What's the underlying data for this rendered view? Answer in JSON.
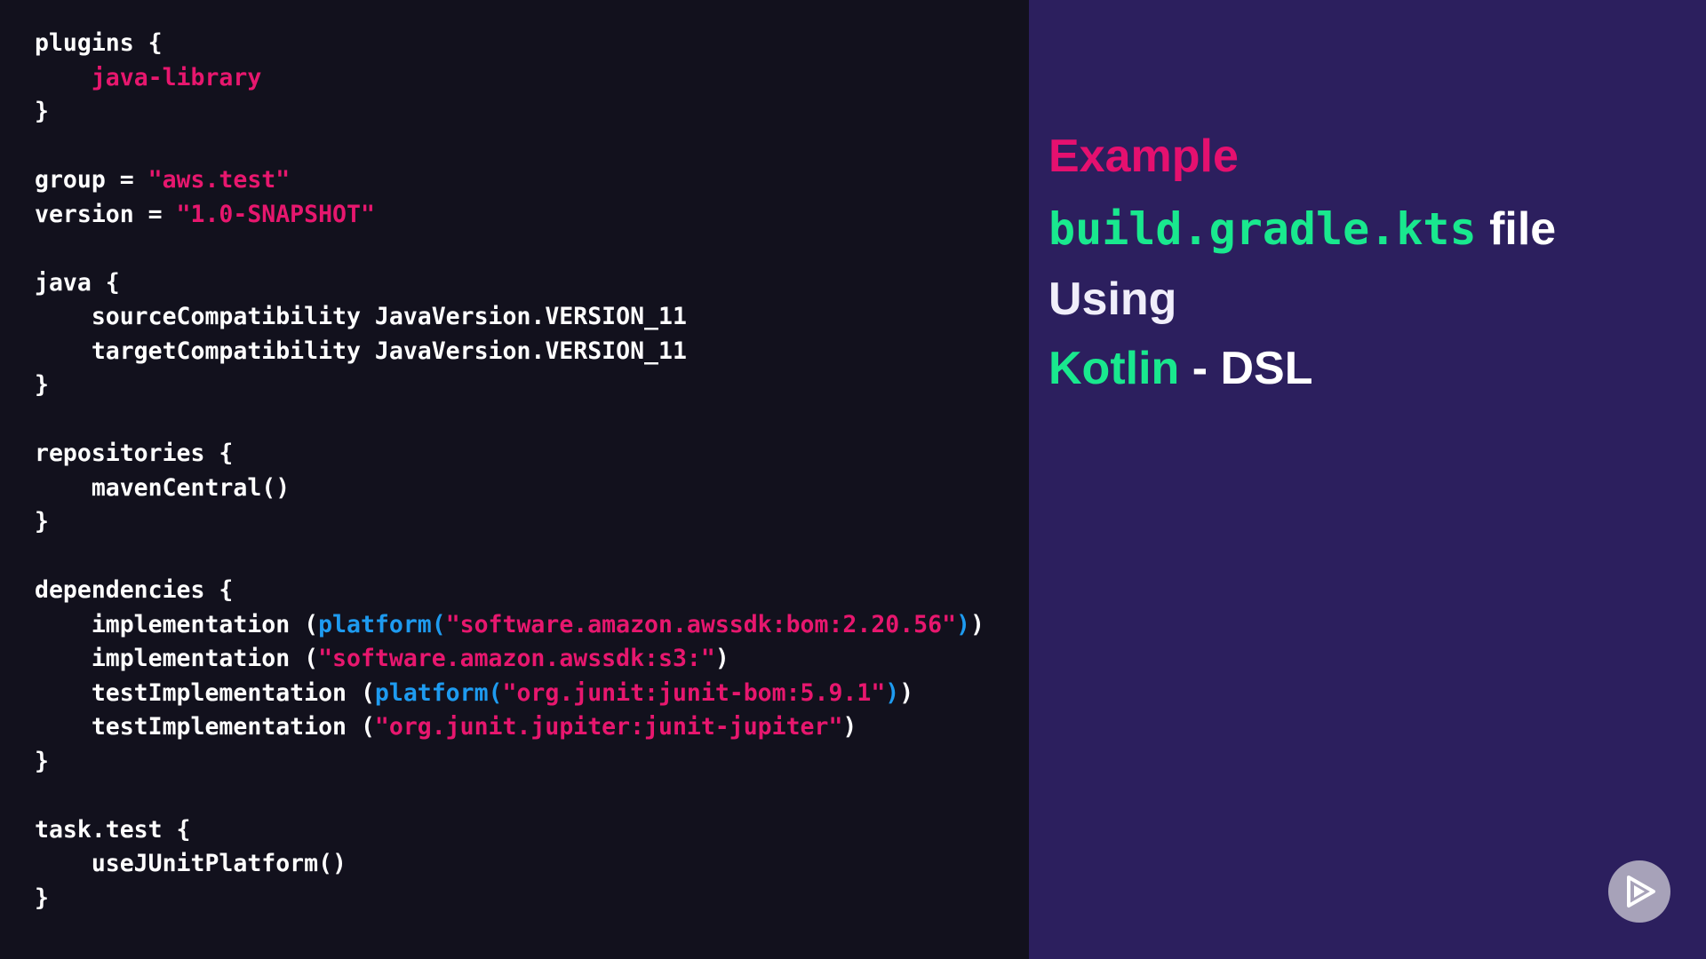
{
  "code_lines": [
    [
      {
        "t": "plugins {",
        "c": "plain"
      }
    ],
    [
      {
        "t": "    ",
        "c": "plain"
      },
      {
        "t": "java-library",
        "c": "plugin"
      }
    ],
    [
      {
        "t": "}",
        "c": "plain"
      }
    ],
    [],
    [
      {
        "t": "group = ",
        "c": "plain"
      },
      {
        "t": "\"aws.test\"",
        "c": "string"
      }
    ],
    [
      {
        "t": "version = ",
        "c": "plain"
      },
      {
        "t": "\"1.0-SNAPSHOT\"",
        "c": "string"
      }
    ],
    [],
    [
      {
        "t": "java {",
        "c": "plain"
      }
    ],
    [
      {
        "t": "    sourceCompatibility JavaVersion.VERSION_11",
        "c": "plain"
      }
    ],
    [
      {
        "t": "    targetCompatibility JavaVersion.VERSION_11",
        "c": "plain"
      }
    ],
    [
      {
        "t": "}",
        "c": "plain"
      }
    ],
    [],
    [
      {
        "t": "repositories {",
        "c": "plain"
      }
    ],
    [
      {
        "t": "    mavenCentral()",
        "c": "plain"
      }
    ],
    [
      {
        "t": "}",
        "c": "plain"
      }
    ],
    [],
    [
      {
        "t": "dependencies {",
        "c": "plain"
      }
    ],
    [
      {
        "t": "    implementation (",
        "c": "plain"
      },
      {
        "t": "platform(",
        "c": "func"
      },
      {
        "t": "\"software.amazon.awssdk:bom:2.20.56\"",
        "c": "string"
      },
      {
        "t": ")",
        "c": "paren-blue"
      },
      {
        "t": ")",
        "c": "plain"
      }
    ],
    [
      {
        "t": "    implementation (",
        "c": "plain"
      },
      {
        "t": "\"software.amazon.awssdk:s3:\"",
        "c": "string"
      },
      {
        "t": ")",
        "c": "plain"
      }
    ],
    [
      {
        "t": "    testImplementation (",
        "c": "plain"
      },
      {
        "t": "platform(",
        "c": "func"
      },
      {
        "t": "\"org.junit:junit-bom:5.9.1\"",
        "c": "string"
      },
      {
        "t": ")",
        "c": "paren-blue"
      },
      {
        "t": ")",
        "c": "plain"
      }
    ],
    [
      {
        "t": "    testImplementation (",
        "c": "plain"
      },
      {
        "t": "\"org.junit.jupiter:junit-jupiter\"",
        "c": "string"
      },
      {
        "t": ")",
        "c": "plain"
      }
    ],
    [
      {
        "t": "}",
        "c": "plain"
      }
    ],
    [],
    [
      {
        "t": "task.test {",
        "c": "plain"
      }
    ],
    [
      {
        "t": "    useJUnitPlatform()",
        "c": "plain"
      }
    ],
    [
      {
        "t": "}",
        "c": "plain"
      }
    ]
  ],
  "slide": {
    "heading": "Example",
    "file_name": "build.gradle.kts",
    "file_word": "file",
    "using": "Using",
    "language": "Kotlin",
    "dsl": " - DSL"
  },
  "colors": {
    "code_bg": "#12111d",
    "slide_bg": "#2c1f5e",
    "accent_pink": "#e5106f",
    "accent_green": "#19e88e",
    "func_blue": "#1e9bf0"
  },
  "icons": {
    "logo": "play-button-icon"
  }
}
